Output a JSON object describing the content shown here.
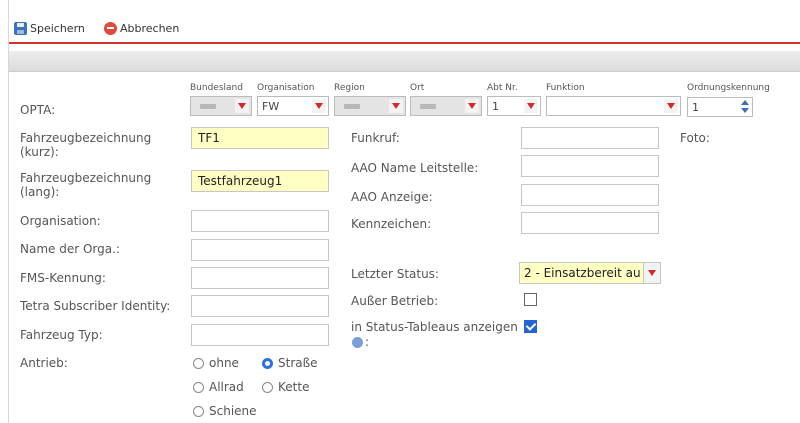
{
  "toolbar": {
    "save_label": "Speichern",
    "cancel_label": "Abbrechen"
  },
  "opta": {
    "label": "OPTA:",
    "headers": [
      "Bundesland",
      "Organisation",
      "Region",
      "Ort",
      "Abt Nr.",
      "Funktion",
      "Ordnungskennung"
    ],
    "organisation_value": "FW",
    "abt_value": "1",
    "ordnung_value": "1"
  },
  "left_form": {
    "kurz_label": "Fahrzeugbezeichnung (kurz):",
    "kurz_value": "TF1",
    "lang_label": "Fahrzeugbezeichnung (lang):",
    "lang_value": "Testfahrzeug1",
    "organisation_label": "Organisation:",
    "orga_name_label": "Name der Orga.:",
    "fms_label": "FMS-Kennung:",
    "tetra_label": "Tetra Subscriber Identity:",
    "typ_label": "Fahrzeug Typ:",
    "antrieb_label": "Antrieb:",
    "antrieb_options": [
      "ohne",
      "Straße",
      "Allrad",
      "Kette",
      "Schiene"
    ]
  },
  "right_form": {
    "funkruf_label": "Funkruf:",
    "aao_name_label": "AAO Name Leitstelle:",
    "aao_anzeige_label": "AAO Anzeige:",
    "kennzeichen_label": "Kennzeichen:",
    "status_label": "Letzter Status:",
    "status_value": "2 - Einsatzbereit au",
    "ausser_label": "Außer Betrieb:",
    "tableau_label": "in Status-Tableaus anzeigen",
    "tableau_suffix": ":",
    "foto_label": "Foto:"
  }
}
